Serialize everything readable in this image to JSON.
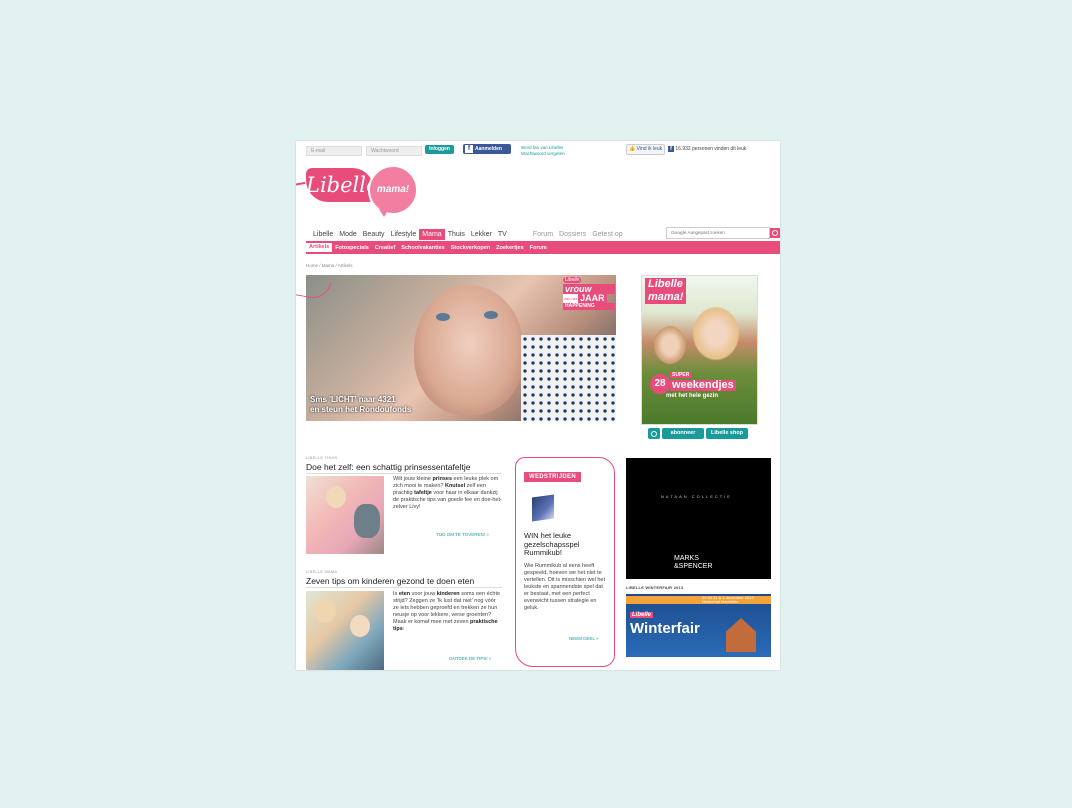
{
  "topbar": {
    "email_placeholder": "E-mail",
    "password_placeholder": "Wachtwoord",
    "login_label": "Inloggen",
    "register_label": "Aanmelden",
    "become_fan": "Word fan van Libelle!",
    "forgot_password": "Wachtwoord vergeten",
    "like_label": "Vind ik leuk",
    "fans_text": "16.932 personen vinden dit leuk"
  },
  "logo": {
    "brand": "Libelle",
    "sub": "mama!"
  },
  "nav": {
    "items": [
      "Libelle",
      "Mode",
      "Beauty",
      "Lifestyle",
      "Mama",
      "Thuis",
      "Lekker",
      "TV"
    ],
    "secondary": [
      "Forum",
      "Dossiers",
      "Getest op"
    ],
    "search_placeholder": "Aangepast zoeken"
  },
  "subnav": {
    "items": [
      "Artikels",
      "Fotospecials",
      "Creatief",
      "Schoolvakanties",
      "Stockverkopen",
      "Zoekertjes",
      "Forum"
    ]
  },
  "breadcrumb": "Home / Mama / Artikels",
  "hero": {
    "badge_brand": "Libelle",
    "badge_line1": "vrouw",
    "badge_line2": "van het",
    "badge_line3": "JAAR",
    "badge_line4": "HAPPENING",
    "caption_line1": "Sms 'LICHT' naar 4321",
    "caption_line2": "en steun het Rondoufonds"
  },
  "magazine": {
    "brand": "Libelle",
    "sub": "mama!",
    "headline_small": "SUPER",
    "headline_num": "28",
    "headline_main": "weekendjes",
    "headline_sub": "met het hele gezin",
    "subscribe_label": "abonneer",
    "shop_label": "Libelle shop"
  },
  "article1": {
    "label": "LIBELLE THUIS",
    "title": "Doe het zelf: een schattig prinsessentafeltje",
    "text_a": "Wilt jouw kleine ",
    "text_b": "prinses",
    "text_c": " een leuke plek om zich mooi te maken? ",
    "text_d": "Knutsel",
    "text_e": " zelf een prachtig ",
    "text_f": "tafeltje",
    "text_g": " voor haar in elkaar dankzij de praktische tips van goede fee en doe-het-zelver Livy!",
    "more": "TIJD OM TE TOVEREN! »"
  },
  "article2": {
    "label": "LIBELLE MAMA",
    "title": "Zeven tips om kinderen gezond te doen eten",
    "text_a": "Is ",
    "text_b": "eten",
    "text_c": " voor jouw ",
    "text_d": "kinderen",
    "text_e": " soms een échte strijd? Zeggen ze 'Ik lust dat niet' nog vóór ze iets hebben geproefd en trekken ze hun neusje op voor lekkere, verse groenten? Maak er komaf mee met zeven ",
    "text_f": "praktische tips",
    "text_g": ":",
    "more": "ONTDEK DE TIPS! »"
  },
  "contest": {
    "label": "WEDSTRIJDEN",
    "title": "WIN het leuke gezelschapsspel Rummikub!",
    "text": "Wie Rummikub al eens heeft gespeeld, hoeven we het niet te vertellen. Dit is misschien wel het leukste en spannendste spel dat er bestaat, met een perfect evenwicht tussen strategie en geluk.",
    "more": "NEEM DEEL »"
  },
  "ad": {
    "small_text": "NATAAN COLLECTIE",
    "brand_line1": "MARKS",
    "brand_line2": "SPENCER",
    "amp": "&"
  },
  "winterfair": {
    "label": "LIBELLE WINTERFAIR 2013",
    "brand": "Libelle",
    "title": "Winterfair",
    "dates": "29 30 31 & 1 december 2013",
    "venue": "Nekkerhal Mechelen"
  },
  "colors": {
    "accent": "#e84c7b",
    "teal": "#199a9b",
    "background": "#e2f2f1"
  }
}
